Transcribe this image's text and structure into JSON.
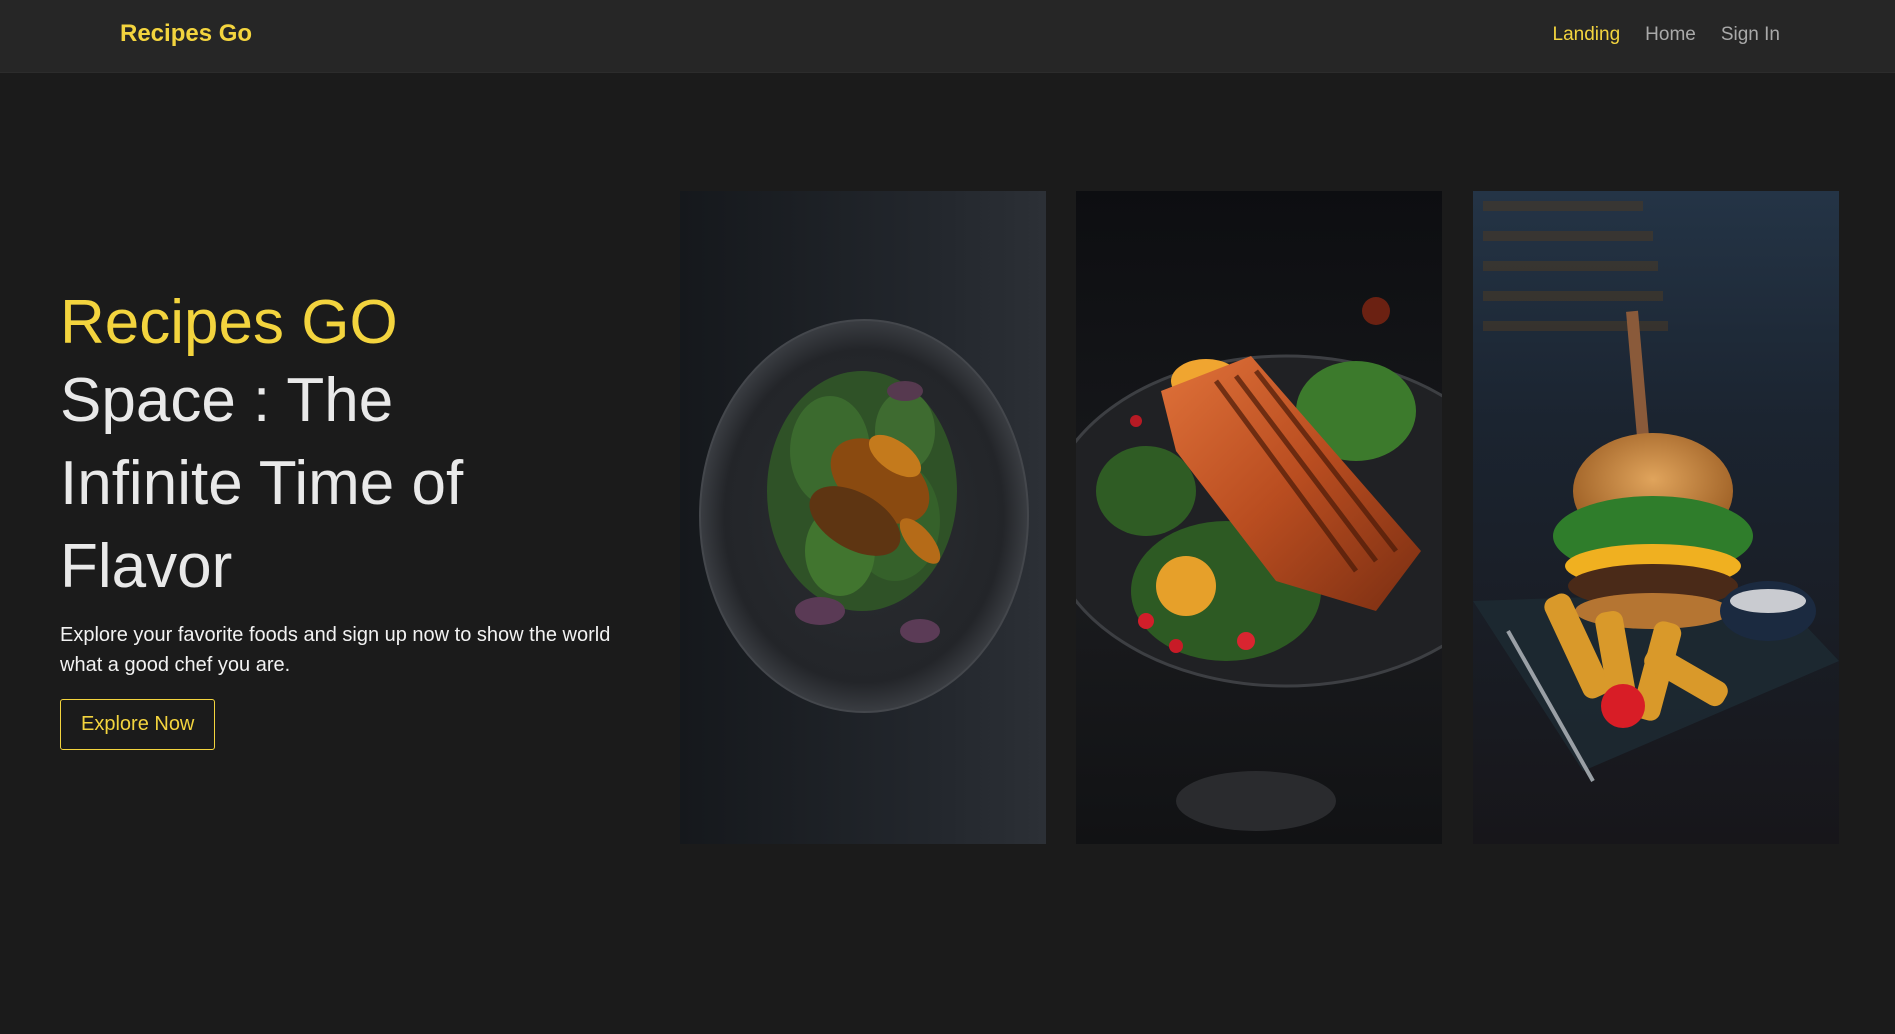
{
  "nav": {
    "brand": "Recipes Go",
    "links": [
      {
        "label": "Landing",
        "active": true
      },
      {
        "label": "Home",
        "active": false
      },
      {
        "label": "Sign In",
        "active": false
      }
    ]
  },
  "hero": {
    "title_accent": "Recipes GO",
    "title_main": "Space : The Infinite Time of Flavor",
    "description": "Explore your favorite foods and sign up now to show the world what a good chef you are.",
    "cta_label": "Explore Now"
  },
  "gallery": [
    {
      "name": "grilled-vegetable-salad-photo"
    },
    {
      "name": "grilled-salmon-photo"
    },
    {
      "name": "burger-with-fries-photo"
    }
  ],
  "colors": {
    "accent": "#f3d43e",
    "background": "#1b1b1b",
    "navbar": "#262626"
  }
}
